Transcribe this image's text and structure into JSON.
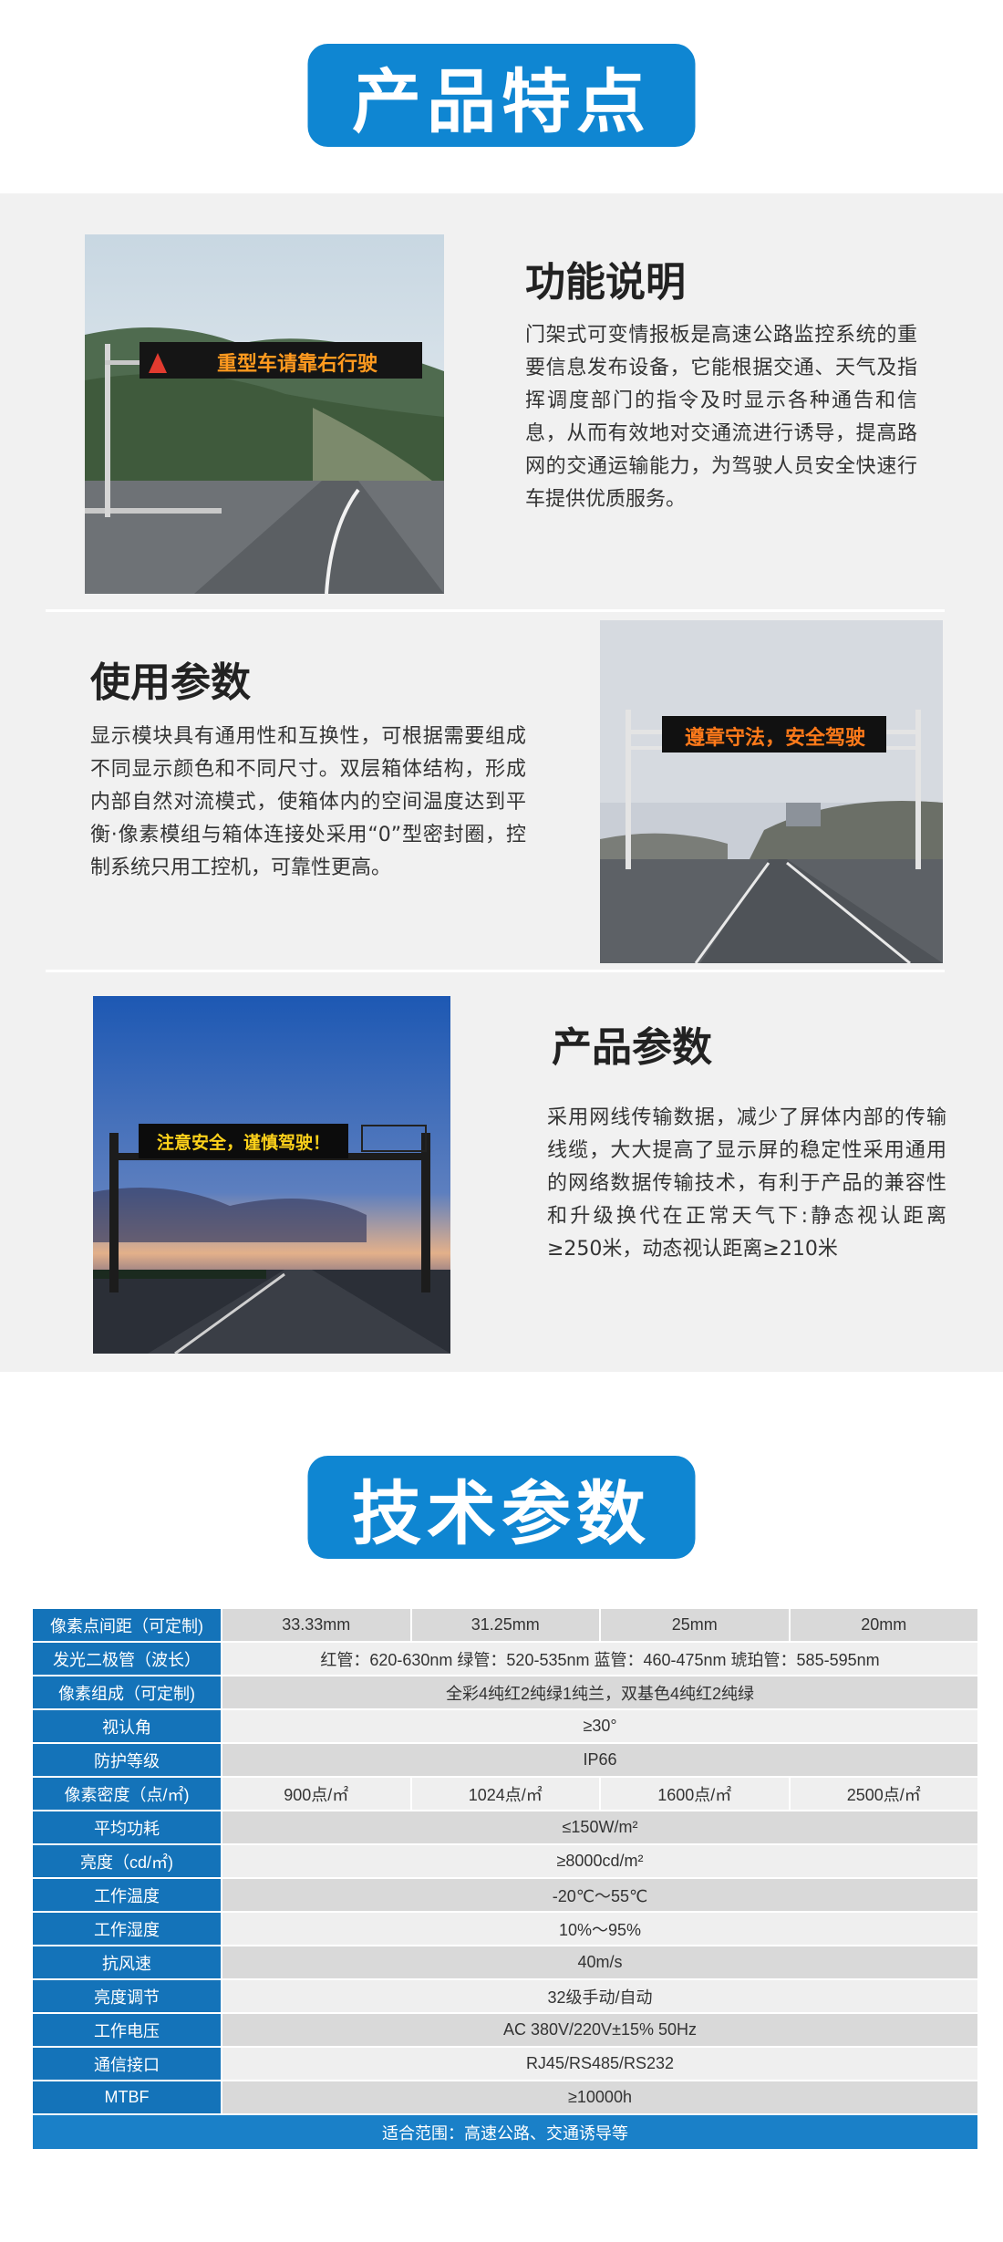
{
  "features": {
    "banner": "产品特点",
    "sections": [
      {
        "title": "功能说明",
        "text": "门架式可变情报板是高速公路监控系统的重要信息发布设备，它能根据交通、天气及指挥调度部门的指令及时显示各种通告和信息，从而有效地对交通流进行诱导，提高路网的交通运输能力，为驾驶人员安全快速行车提供优质服务。",
        "sign_text": "重型车请靠右行驶"
      },
      {
        "title": "使用参数",
        "text": "显示模块具有通用性和互换性，可根据需要组成不同显示颜色和不同尺寸。双层箱体结构，形成内部自然对流模式，使箱体内的空间温度达到平衡·像素模组与箱体连接处采用“0”型密封圈，控制系统只用工控机，可靠性更高。",
        "sign_text": "遵章守法，安全驾驶"
      },
      {
        "title": "产品参数",
        "text": "采用网线传输数据，减少了屏体内部的传输线缆，大大提高了显示屏的稳定性采用通用的网络数据传输技术，有利于产品的兼容性和升级换代在正常天气下:静态视认距离≥250米，动态视认距离≥210米",
        "sign_text": "注意安全，谨慎驾驶！"
      }
    ]
  },
  "specs": {
    "banner": "技术参数",
    "rows": [
      {
        "label": "像素点间距（可定制)",
        "values": [
          "33.33mm",
          "31.25mm",
          "25mm",
          "20mm"
        ]
      },
      {
        "label": "发光二极管（波长）",
        "values": [
          "红管：620-630nm   绿管：520-535nm  蓝管：460-475nm  琥珀管：585-595nm"
        ]
      },
      {
        "label": "像素组成（可定制)",
        "values": [
          "全彩4纯红2纯绿1纯兰，双基色4纯红2纯绿"
        ]
      },
      {
        "label": "视认角",
        "values": [
          "≥30°"
        ]
      },
      {
        "label": "防护等级",
        "values": [
          "IP66"
        ]
      },
      {
        "label": "像素密度（点/㎡)",
        "values": [
          "900点/㎡",
          "1024点/㎡",
          "1600点/㎡",
          "2500点/㎡"
        ]
      },
      {
        "label": "平均功耗",
        "values": [
          "≤150W/m²"
        ]
      },
      {
        "label": "亮度（cd/㎡)",
        "values": [
          "≥8000cd/m²"
        ]
      },
      {
        "label": "工作温度",
        "values": [
          "-20℃～55℃"
        ]
      },
      {
        "label": "工作湿度",
        "values": [
          "10%～95%"
        ]
      },
      {
        "label": "抗风速",
        "values": [
          "40m/s"
        ]
      },
      {
        "label": "亮度调节",
        "values": [
          "32级手动/自动"
        ]
      },
      {
        "label": "工作电压",
        "values": [
          "AC 380V/220V±15%    50Hz"
        ]
      },
      {
        "label": "通信接口",
        "values": [
          "RJ45/RS485/RS232"
        ]
      },
      {
        "label": "MTBF",
        "values": [
          "≥10000h"
        ]
      }
    ],
    "footer": "适合范围：高速公路、交通诱导等"
  }
}
